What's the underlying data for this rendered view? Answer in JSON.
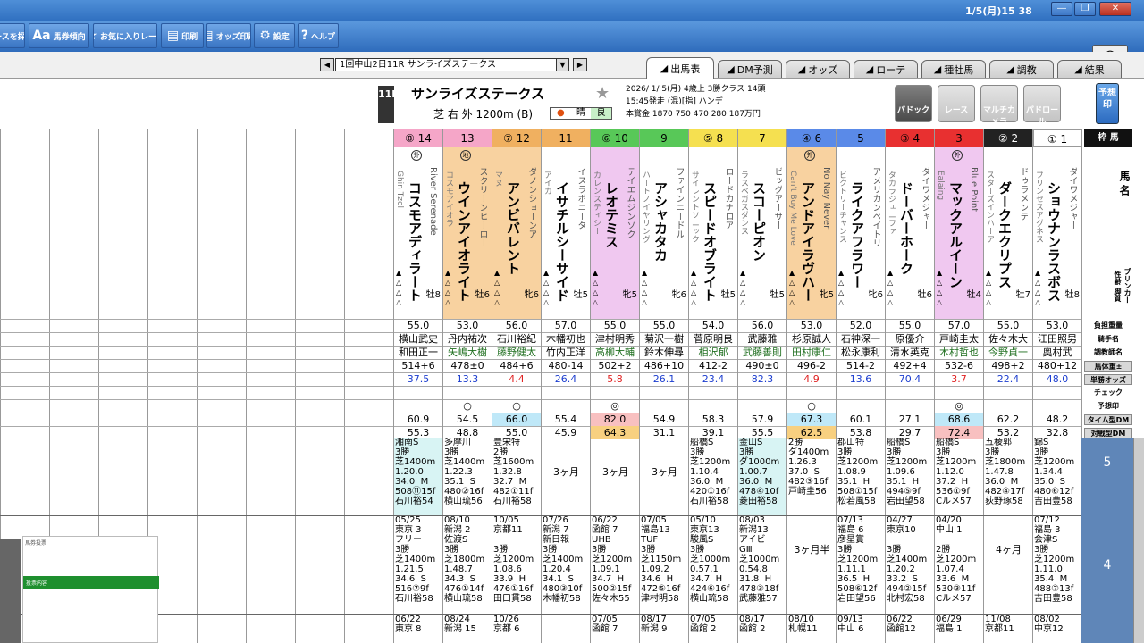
{
  "titlebar": {
    "clock": "1/5(月)15 38"
  },
  "toolbar": [
    {
      "label": "レースを探す",
      "icon": "search-icon"
    },
    {
      "label": "馬券傾向",
      "icon": "text-size-icon"
    },
    {
      "label": "お気に入りレース",
      "icon": "star-icon"
    },
    {
      "label": "印刷",
      "icon": "print-icon"
    },
    {
      "label": "オッズ印刷",
      "icon": "print-icon"
    },
    {
      "label": "設定",
      "icon": "gear-icon"
    },
    {
      "label": "ヘルプ",
      "icon": "help-icon"
    }
  ],
  "nav": {
    "race_select": "1回中山2日11R サンライズステークス",
    "tabs": [
      "出馬表",
      "DM予測",
      "オッズ",
      "ローテ",
      "種牡馬",
      "調教",
      "結果"
    ]
  },
  "race": {
    "no": "11R",
    "name": "サンライズステークス",
    "course": "芝 右 外 1200m (B)",
    "weather": [
      "晴",
      "良"
    ],
    "date_line": "2026/ 1/ 5(月)  4歳上  3勝クラス  14頭",
    "start_line": "15:45発走 (混)[指] ハンデ",
    "prize_line": "本賞金 1870 750 470 280 187万円",
    "buttons": [
      "パドック",
      "レース",
      "マルチカメラ",
      "パドロール"
    ],
    "yosou_button": "予想印"
  },
  "legend": {
    "waku_header": "枠 馬",
    "rows": [
      "負担重量",
      "騎手名",
      "調教師名",
      "馬体重±",
      "単勝オッズ",
      "チェック",
      "予想印",
      "タイム型DM",
      "対戦型DM"
    ],
    "side_top": "馬 名",
    "side_bottom": "ブリンカー 性齢 脚質",
    "row_numbers": [
      "5",
      "4"
    ]
  },
  "horses": [
    {
      "num": "14",
      "waku": "⑧",
      "color": "#f5a6c8",
      "name": "コスモアディラート",
      "sire": "River Serenade",
      "dam": "Ghin Tzel",
      "mark": "外",
      "sex": "牡8",
      "weight": "55.0",
      "jockey": "横山武史",
      "trainer": "和田正一",
      "body": "514+6",
      "odds": "37.5",
      "odds_red": false,
      "yosou": "",
      "tdm": "60.9",
      "vdm": "55.3",
      "runs": [
        "湘南S\n3勝\n芝1400m\n1.20.0\n34.0  M\n508⑪15f\n石川裕54",
        "05/25\n東京 3\nフリー\n3勝\n芝1400m\n1.21.5\n34.6  S\n516⑦9f\n石川裕58",
        "06/22\n東京 8"
      ]
    },
    {
      "num": "13",
      "waku": "",
      "color": "#f5a6c8",
      "name": "ウインアイオライト",
      "sire": "スクリーンヒーロー",
      "dam": "コスモアイオラ",
      "mark": "地",
      "sex": "牡6",
      "weight": "53.0",
      "jockey": "丹内祐次",
      "trainer": "矢嶋大樹",
      "body": "478±0",
      "odds": "13.3",
      "odds_red": false,
      "yosou": "○",
      "tdm": "54.5",
      "vdm": "48.8",
      "runs": [
        "多摩川\n3勝\n芝1400m\n1.22.3\n35.1  S\n480②16f\n横山琉56",
        "08/10\n新潟 2\n佐渡S\n3勝\n芝1800m\n1.48.7\n34.3  S\n476①14f\n横山琉58",
        "08/24\n新潟 15"
      ]
    },
    {
      "num": "12",
      "waku": "⑦",
      "color": "#f0b060",
      "name": "アンビバレント",
      "sire": "ダノンショーンア",
      "dam": "マヌ",
      "mark": "",
      "sex": "牝6",
      "weight": "56.0",
      "jockey": "石川裕紀",
      "trainer": "藤野健太",
      "body": "484+6",
      "odds": "4.4",
      "odds_red": true,
      "yosou": "○",
      "tdm": "66.0",
      "vdm": "55.0",
      "runs": [
        "豊栄特\n2勝\n芝1600m\n1.32.8\n32.7  M\n482①11f\n石川裕58",
        "10/05\n京都11\n\n3勝\n芝1200m\n1.08.6\n33.9  H\n476①16f\n田口貫58",
        "10/26\n京都 6"
      ]
    },
    {
      "num": "11",
      "waku": "",
      "color": "#f0b060",
      "name": "イサチルシーサイド",
      "sire": "イスラボニータ",
      "dam": "アイカ",
      "mark": "",
      "sex": "牡5",
      "weight": "57.0",
      "jockey": "木幡初也",
      "trainer": "竹内正洋",
      "body": "480-14",
      "odds": "26.4",
      "odds_red": false,
      "yosou": "",
      "tdm": "55.4",
      "vdm": "45.9",
      "runs": [
        "\n\n\n3ヶ月",
        "07/26\n新潟 7\n新日報\n3勝\n芝1400m\n1.20.4\n34.1  S\n480③10f\n木幡初58",
        "\n"
      ]
    },
    {
      "num": "10",
      "waku": "⑥",
      "color": "#58c858",
      "name": "レオテミス",
      "sire": "テイエムジンソク",
      "dam": "カレンスティシー",
      "mark": "",
      "sex": "牝5",
      "weight": "55.0",
      "jockey": "津村明秀",
      "trainer": "高柳大輔",
      "body": "502+2",
      "odds": "5.8",
      "odds_red": true,
      "yosou": "◎",
      "tdm": "82.0",
      "vdm": "64.3",
      "runs": [
        "\n\n\n3ヶ月",
        "06/22\n函館 7\nUHB\n3勝\n芝1200m\n1.09.1\n34.7  H\n500②15f\n佐々木55",
        "07/05\n函館 7"
      ]
    },
    {
      "num": "9",
      "waku": "",
      "color": "#58c858",
      "name": "アシャカタカ",
      "sire": "ファインニードル",
      "dam": "ハートノイヤリング",
      "mark": "",
      "sex": "牝6",
      "weight": "55.0",
      "jockey": "菊沢一樹",
      "trainer": "鈴木伸尋",
      "body": "486+10",
      "odds": "26.1",
      "odds_red": false,
      "yosou": "",
      "tdm": "54.9",
      "vdm": "31.1",
      "runs": [
        "\n\n\n3ヶ月",
        "07/05\n福島13\nTUF\n3勝\n芝1150m\n1.09.2\n34.6  H\n472⑤16f\n津村明58",
        "08/17\n新潟 9"
      ]
    },
    {
      "num": "8",
      "waku": "⑤",
      "color": "#f5e050",
      "name": "スピードオブライト",
      "sire": "ロードカナロア",
      "dam": "サイレントソニック",
      "mark": "",
      "sex": "牡5",
      "weight": "54.0",
      "jockey": "菅原明良",
      "trainer": "相沢郁",
      "body": "412-2",
      "odds": "23.4",
      "odds_red": false,
      "yosou": "",
      "tdm": "58.3",
      "vdm": "39.1",
      "runs": [
        "船橋S\n3勝\n芝1200m\n1.10.4\n36.0  M\n420①16f\n石川裕58",
        "05/10\n東京13\n駿風S\n3勝\n芝1000m\n0.57.1\n34.7  H\n424⑥16f\n横山琉58",
        "07/05\n函館 2"
      ]
    },
    {
      "num": "7",
      "waku": "",
      "color": "#f5e050",
      "name": "スコーピオン",
      "sire": "ビッグアーサー",
      "dam": "ラスベガスダンス",
      "mark": "",
      "sex": "牡5",
      "weight": "56.0",
      "jockey": "武藤雅",
      "trainer": "武藤善則",
      "body": "490±0",
      "odds": "82.3",
      "odds_red": false,
      "yosou": "",
      "tdm": "57.9",
      "vdm": "55.5",
      "runs": [
        "釜山S\n3勝\nダ1000m\n1.00.7\n36.0  M\n478④10f\n菱田裕58",
        "08/03\n新潟13\nアイビ\nGⅢ\n芝1000m\n0.54.8\n31.8  H\n478③18f\n武藤雅57",
        "08/17\n函館 2"
      ]
    },
    {
      "num": "6",
      "waku": "④",
      "color": "#5a8ae8",
      "name": "アンドアイラヴハー",
      "sire": "No Nay Never",
      "dam": "Can't Buy Me Love",
      "mark": "外",
      "sex": "牝5",
      "weight": "53.0",
      "jockey": "杉原誠人",
      "trainer": "田村康仁",
      "body": "496-2",
      "odds": "4.9",
      "odds_red": true,
      "yosou": "○",
      "tdm": "67.3",
      "vdm": "62.5",
      "runs": [
        "2勝\nダ1400m\n1.26.3\n37.0  S\n482③16f\n戸崎圭56",
        "\n\n\n3ヶ月半",
        "08/10\n札幌11"
      ]
    },
    {
      "num": "5",
      "waku": "",
      "color": "#5a8ae8",
      "name": "ライクアフラワー",
      "sire": "アメリカンペイトリ",
      "dam": "ビクトリーチャンス",
      "mark": "",
      "sex": "牝6",
      "weight": "52.0",
      "jockey": "石神深一",
      "trainer": "松永康利",
      "body": "514-2",
      "odds": "13.6",
      "odds_red": false,
      "yosou": "",
      "tdm": "60.1",
      "vdm": "53.8",
      "runs": [
        "郡山特\n3勝\n芝1200m\n1.08.9\n35.1  H\n508①15f\n松若風58",
        "07/13\n福島 6\n彦星賞\n3勝\n芝1200m\n1.11.1\n36.5  H\n508⑥12f\n岩田望56",
        "09/13\n中山 6"
      ]
    },
    {
      "num": "4",
      "waku": "③",
      "color": "#e83030",
      "name": "ドーバーホーク",
      "sire": "ダイワメジャー",
      "dam": "タカラジェニファ",
      "mark": "",
      "sex": "牡6",
      "weight": "55.0",
      "jockey": "原優介",
      "trainer": "清水英克",
      "body": "492+4",
      "odds": "70.4",
      "odds_red": false,
      "yosou": "",
      "tdm": "27.1",
      "vdm": "29.7",
      "runs": [
        "船橋S\n3勝\n芝1200m\n1.09.6\n35.1  H\n494⑤9f\n岩田望58",
        "04/27\n東京10\n\n3勝\n芝1400m\n1.20.2\n33.2  S\n494②15f\n北村宏58",
        "06/22\n函館12"
      ]
    },
    {
      "num": "3",
      "waku": "",
      "color": "#e83030",
      "name": "マックアルイーン",
      "sire": "Blue Point",
      "dam": "Ealaing",
      "mark": "外",
      "sex": "牡4",
      "weight": "57.0",
      "jockey": "戸崎圭太",
      "trainer": "木村哲也",
      "body": "532-6",
      "odds": "3.7",
      "odds_red": true,
      "yosou": "◎",
      "tdm": "68.6",
      "vdm": "72.4",
      "runs": [
        "船橋S\n3勝\n芝1200m\n1.12.0\n37.2  H\n536①9f\nCルメ57",
        "04/20\n中山 1\n\n2勝\n芝1200m\n1.07.4\n33.6  M\n530③11f\nCルメ57",
        "06/29\n福島 1"
      ]
    },
    {
      "num": "2",
      "waku": "②",
      "color": "#222222",
      "name": "ダークエクリプス",
      "sire": "ドゥラメンテ",
      "dam": "スターズインハーア",
      "mark": "",
      "sex": "牡7",
      "weight": "55.0",
      "jockey": "佐々木大",
      "trainer": "今野貞一",
      "body": "498+2",
      "odds": "22.4",
      "odds_red": false,
      "yosou": "",
      "tdm": "62.2",
      "vdm": "53.2",
      "runs": [
        "五稜郭\n3勝\n芝1800m\n1.47.8\n36.0  M\n482④17f\n荻野琢58",
        "\n\n\n4ヶ月",
        "11/08\n京都11"
      ]
    },
    {
      "num": "1",
      "waku": "①",
      "color": "#ffffff",
      "name": "ショウナンラスボス",
      "sire": "ダイワメジャー",
      "dam": "プリンセスアグネス",
      "mark": "",
      "sex": "牡8",
      "weight": "53.0",
      "jockey": "江田照男",
      "trainer": "奥村武",
      "body": "480+12",
      "odds": "48.0",
      "odds_red": false,
      "yosou": "",
      "tdm": "48.2",
      "vdm": "32.8",
      "runs": [
        "錦S\n3勝\n芝1200m\n1.34.4\n35.0  S\n480⑥12f\n吉田豊58",
        "07/12\n福島 3\n会津S\n3勝\n芝1200m\n1.11.0\n35.4  M\n488⑦13f\n吉田豊58",
        "08/02\n中京12"
      ]
    }
  ],
  "popup": {
    "title": "馬券投票",
    "header": "投票内容"
  }
}
